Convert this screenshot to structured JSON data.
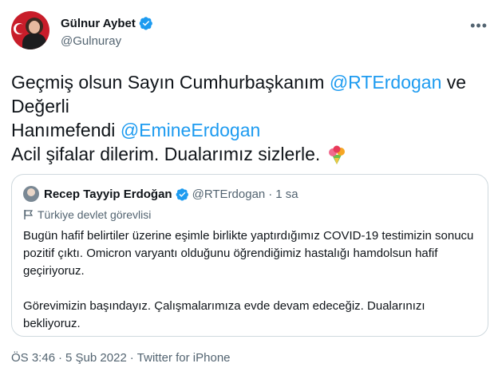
{
  "author": {
    "display_name": "Gülnur Aybet",
    "handle": "@Gulnuray"
  },
  "menu_icon": "more-horizontal-icon",
  "tweet": {
    "line1_text": "Geçmiş olsun Sayın Cumhurbaşkanım ",
    "line1_mention": "@RTErdogan",
    "line1_tail": " ve",
    "line2_text": "Değerli",
    "line3_text": "Hanımefendi ",
    "line3_mention": "@EmineErdogan",
    "line4_text": "Acil şifalar dilerim. Dualarımız sizlerle.",
    "emoji": "bouquet-emoji"
  },
  "quoted_tweet": {
    "display_name": "Recep Tayyip Erdoğan",
    "handle": "@RTErdogan",
    "separator": "·",
    "time": "1 sa",
    "label": "Türkiye devlet görevlisi",
    "paragraph1": "Bugün hafif belirtiler üzerine eşimle birlikte yaptırdığımız COVID-19 testimizin sonucu pozitif çıktı. Omicron varyantı olduğunu öğrendiğimiz hastalığı hamdolsun hafif geçiriyoruz.",
    "paragraph2": "Görevimizin başındayız. Çalışmalarımıza evde devam edeceğiz. Dualarınızı bekliyoruz."
  },
  "footer": {
    "time": "ÖS 3:46",
    "date": "5 Şub 2022",
    "source": "Twitter for iPhone",
    "separator": "·"
  },
  "colors": {
    "link": "#1d9bf0",
    "muted": "#536471",
    "border": "#cfd9de"
  }
}
